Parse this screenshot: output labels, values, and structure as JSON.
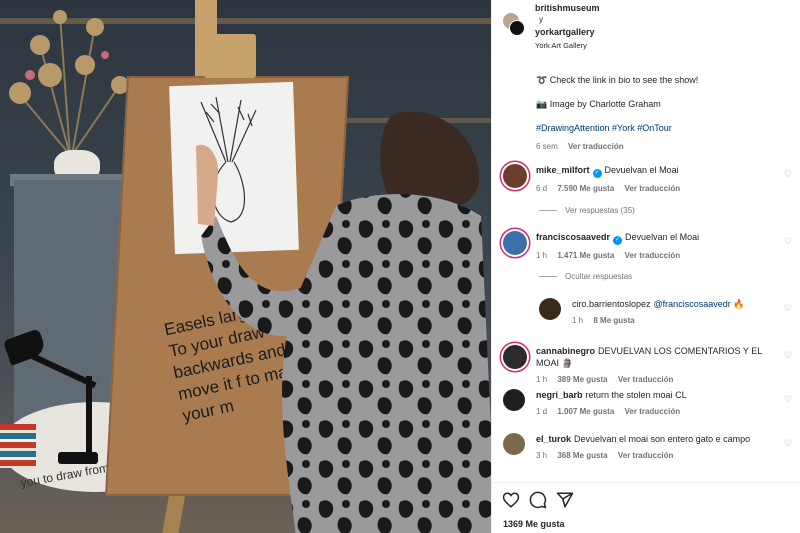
{
  "post": {
    "author": "britishmuseum",
    "connector": "y",
    "coauthor": "yorkartgallery",
    "location": "York Art Gallery",
    "caption_lines": [
      "➰ Check the link in bio to see the show!",
      "📷 Image by Charlotte Graham",
      "#DrawingAttention #York #OnTour"
    ],
    "time": "6 sem",
    "translate_label": "Ver traducción",
    "board_text": "Easels larger s body. To your draw backwards and move it f to make your m",
    "table_text": "you to draw from."
  },
  "comments": [
    {
      "user": "mike_milfort",
      "verified": true,
      "text": "Devuelvan el Moai",
      "time": "6 d",
      "likes": "7.590 Me gusta",
      "translate": "Ver traducción",
      "replies": "Ver respuestas (35)"
    },
    {
      "user": "franciscosaavedr",
      "verified": true,
      "text": "Devuelvan el Moai",
      "time": "1 h",
      "likes": "1.471 Me gusta",
      "translate": "Ver traducción",
      "replies": "Ocultar respuestas"
    },
    {
      "user": "ciro.barrientoslopez",
      "mention": "@franciscosaavedr",
      "emoji": "🔥",
      "time": "1 h",
      "likes": "8 Me gusta"
    },
    {
      "user": "cannabinegro",
      "text": "DEVUELVAN LOS COMENTARIOS Y EL MOAI 🗿",
      "time": "1 h",
      "likes": "389 Me gusta",
      "translate": "Ver traducción"
    },
    {
      "user": "negri_barb",
      "text": "return the stolen moai CL",
      "time": "1 d",
      "likes": "1.007 Me gusta",
      "translate": "Ver traducción"
    },
    {
      "user": "el_turok",
      "text": "Devuelvan el moai son entero gato e campo",
      "time": "3 h",
      "likes": "368 Me gusta",
      "translate": "Ver traducción"
    }
  ],
  "footer": {
    "likes": "1369 Me gusta"
  },
  "icons": [
    "heart-icon",
    "comment-icon",
    "share-icon",
    "verified-icon"
  ],
  "colors": {
    "link": "#00376b",
    "verified": "#0095f6",
    "story_ring": "#d62976"
  }
}
